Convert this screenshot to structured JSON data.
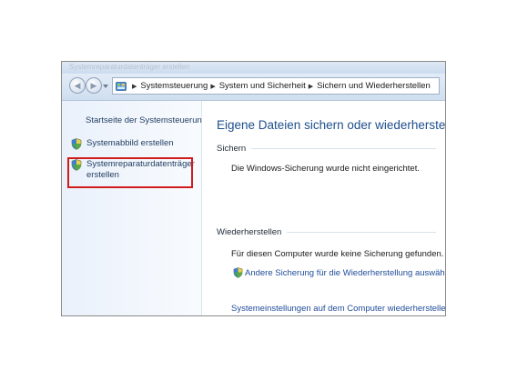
{
  "window": {
    "title": "Systemreparaturdatenträger erstellen"
  },
  "navigation": {
    "back_icon": "back-arrow-icon",
    "forward_icon": "forward-arrow-icon",
    "breadcrumbs": [
      "Systemsteuerung",
      "System und Sicherheit",
      "Sichern und Wiederherstellen"
    ]
  },
  "sidebar": {
    "home_link": "Startseite der Systemsteuerung",
    "tasks": [
      {
        "label": "Systemabbild erstellen",
        "icon": "shield-icon"
      },
      {
        "label_line1": "Systemreparaturdatenträger",
        "label_line2": "erstellen",
        "icon": "shield-icon",
        "highlighted": true
      }
    ]
  },
  "main": {
    "heading": "Eigene Dateien sichern oder wiederherstellen",
    "backup_section": {
      "title": "Sichern",
      "status": "Die Windows-Sicherung wurde nicht eingerichtet."
    },
    "restore_section": {
      "title": "Wiederherstellen",
      "status": "Für diesen Computer wurde keine Sicherung gefunden.",
      "link_other": "Andere Sicherung für die Wiederherstellung auswählen",
      "link_system": "Systemeinstellungen auf dem Computer wiederherstellen"
    }
  },
  "colors": {
    "link": "#1f4c99",
    "heading": "#1e4f8c",
    "highlight": "#d11c1c"
  }
}
